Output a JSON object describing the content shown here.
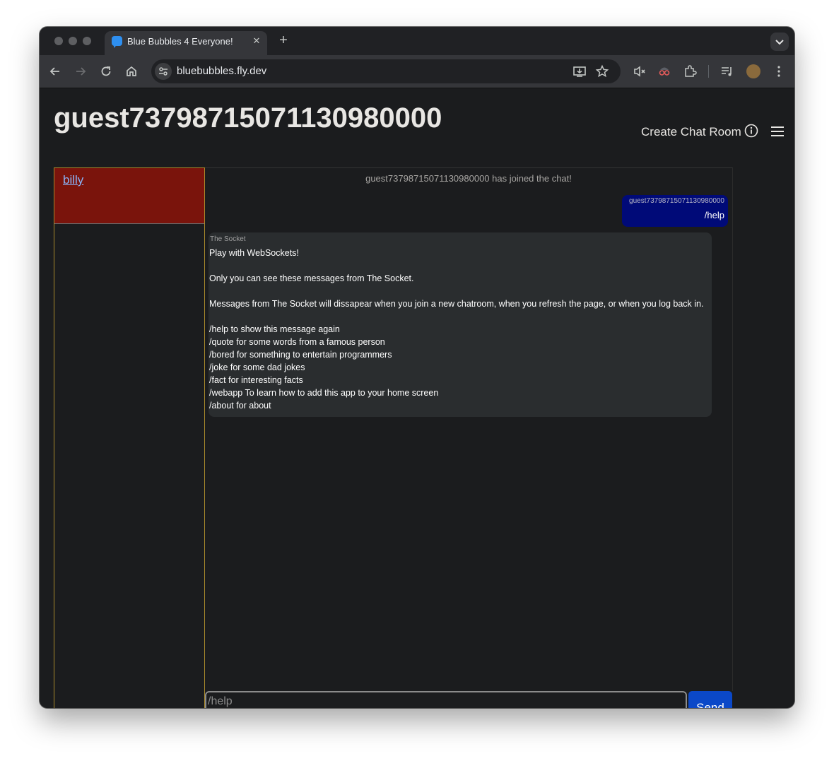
{
  "browser": {
    "tab": {
      "title": "Blue Bubbles 4 Everyone!",
      "close_glyph": "✕"
    },
    "new_tab_glyph": "+",
    "url": "bluebubbles.fly.dev"
  },
  "header": {
    "username": "guest73798715071130980000",
    "create_room_label": "Create Chat Room"
  },
  "sidebar": {
    "rooms": [
      {
        "name": "billy"
      }
    ]
  },
  "chat": {
    "join_notice": "guest73798715071130980000 has joined the chat!",
    "my_message": {
      "sender": "guest73798715071130980000",
      "text": "/help"
    },
    "bot_message": {
      "sender": "The Socket",
      "lines": [
        "Play with WebSockets!",
        "",
        "Only you can see these messages from The Socket.",
        "",
        "Messages from The Socket will dissapear when you join a new chatroom, when you refresh the page, or when you log back in.",
        "",
        "/help to show this message again",
        "/quote for some words from a famous person",
        "/bored for something to entertain programmers",
        "/joke for some dad jokes",
        "/fact for interesting facts",
        "/webapp To learn how to add this app to your home screen",
        "/about for about"
      ]
    }
  },
  "composer": {
    "placeholder": "/help",
    "send_label": "Send"
  },
  "colors": {
    "page_background": "#1b1c1e",
    "active_room": "#7a140c",
    "my_bubble": "#000a78",
    "bot_bubble": "#2a2d2f",
    "send_button": "#0b48c8",
    "sidebar_border": "#a88a2b"
  }
}
